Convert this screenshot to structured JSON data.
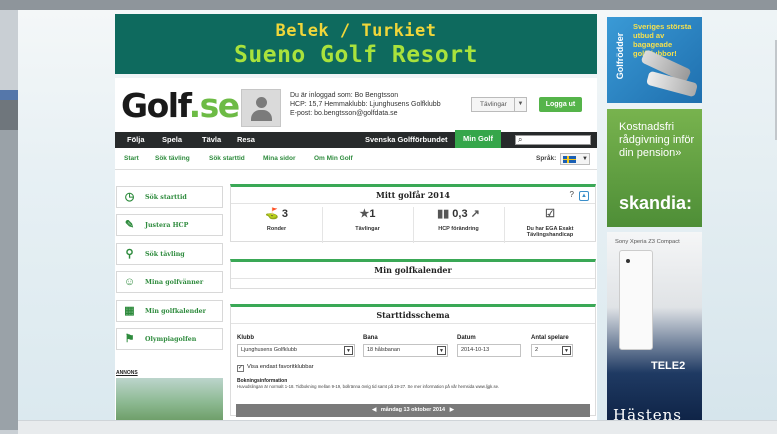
{
  "banner": {
    "line1": "Belek / Turkiet",
    "line2": "Sueno Golf Resort"
  },
  "header": {
    "logo_text": "Golf",
    "logo_dot": ".se",
    "logged_in_label": "Du är inloggad som: Bo Bengtsson",
    "hcp_line": "HCP: 15,7   Hemmaklubb: Ljunghusens Golfklubb",
    "email_line": "E-post: bo.bengtsson@golfdata.se",
    "competitions_select": "Tävlingar",
    "logout_button": "Logga ut"
  },
  "nav": {
    "items": [
      "Följa",
      "Spela",
      "Tävla",
      "Resa"
    ],
    "federation": "Svenska Golfförbundet",
    "active": "Min Golf",
    "search_placeholder": ""
  },
  "subnav": {
    "items": [
      "Start",
      "Sök tävling",
      "Sök starttid",
      "Mina sidor",
      "Om Min Golf"
    ],
    "language_label": "Språk:"
  },
  "sidebar": {
    "items": [
      {
        "label": "Sök starttid",
        "icon": "clock-icon"
      },
      {
        "label": "Justera HCP",
        "icon": "wrench-icon"
      },
      {
        "label": "Sök tävling",
        "icon": "search-icon"
      },
      {
        "label": "Mina golfvänner",
        "icon": "friends-icon"
      },
      {
        "label": "Min golfkalender",
        "icon": "calendar-icon"
      },
      {
        "label": "Olympiagolfen",
        "icon": "flag-icon"
      }
    ],
    "ad_label": "ANNONS"
  },
  "golfyear": {
    "title": "Mitt golfår 2014",
    "help": "?",
    "stats": [
      {
        "value": "3",
        "caption": "Ronder"
      },
      {
        "value": "1",
        "caption": "Tävlingar"
      },
      {
        "value": "0,3",
        "caption": "HCP förändring"
      },
      {
        "value": "",
        "caption": "Du har EGA Exakt Tävlingshandicap"
      }
    ]
  },
  "calendar": {
    "title": "Min golfkalender"
  },
  "tee": {
    "title": "Starttidsschema",
    "club_label": "Klubb",
    "club_value": "Ljunghusens Golfklubb",
    "course_label": "Bana",
    "course_value": "18 hålsbanan",
    "date_label": "Datum",
    "date_value": "2014-10-13",
    "players_label": "Antal spelare",
    "players_value": "2",
    "favorites_label": "Visa endast favoritklubbar",
    "info_title": "Bokningsinformation",
    "info_text": "Huvudslingan är normalt 1-18. Tidbokning mellan 9-19, bollränna övrig tid samt på 19-27. Se mer information på vår hemsida www.ljgk.se.",
    "date_bar": "måndag 13 oktober 2014"
  },
  "ads": {
    "golfrodder_brand": "Golfrödder",
    "golfrodder_text": "Sveriges största utbud av bagageade golfklubbor!",
    "skandia_text": "Kostnadsfri rådgivning inför din pension»",
    "skandia_brand": "skandia:",
    "sony_header": "Sony Xperia Z3 Compact",
    "tele2": "TELE2",
    "hastens": "Hästens"
  },
  "colors": {
    "brand_green": "#35a64a",
    "nav_dark": "#272a2b",
    "banner_teal": "#0e6a5e"
  }
}
